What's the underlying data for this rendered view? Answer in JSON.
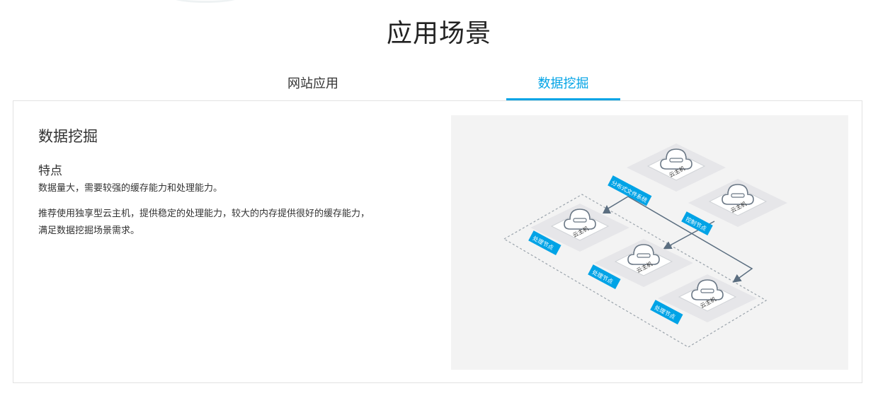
{
  "section": {
    "title": "应用场景"
  },
  "tabs": [
    {
      "label": "网站应用",
      "active": false
    },
    {
      "label": "数据挖掘",
      "active": true
    }
  ],
  "panel": {
    "title": "数据挖掘",
    "feature_heading": "特点",
    "paragraphs": [
      "数据量大，需要较强的缓存能力和处理能力。",
      "推荐使用独享型云主机，提供稳定的处理能力，较大的内存提供很好的缓存能力，满足数据挖掘场景需求。"
    ]
  },
  "diagram": {
    "labels": {
      "dfs": "分布式文件系统",
      "control": "控制节点",
      "proc_left": "处理节点",
      "proc_mid": "处理节点",
      "proc_right": "处理节点"
    },
    "cloud_host": "云主机",
    "colors": {
      "accent": "#00a3e6",
      "arrow": "#5b6e80",
      "tile": "#e6e6e9"
    }
  },
  "colors": {
    "accent": "#00a3e6",
    "text": "#333333",
    "border": "#e2e2e2"
  }
}
